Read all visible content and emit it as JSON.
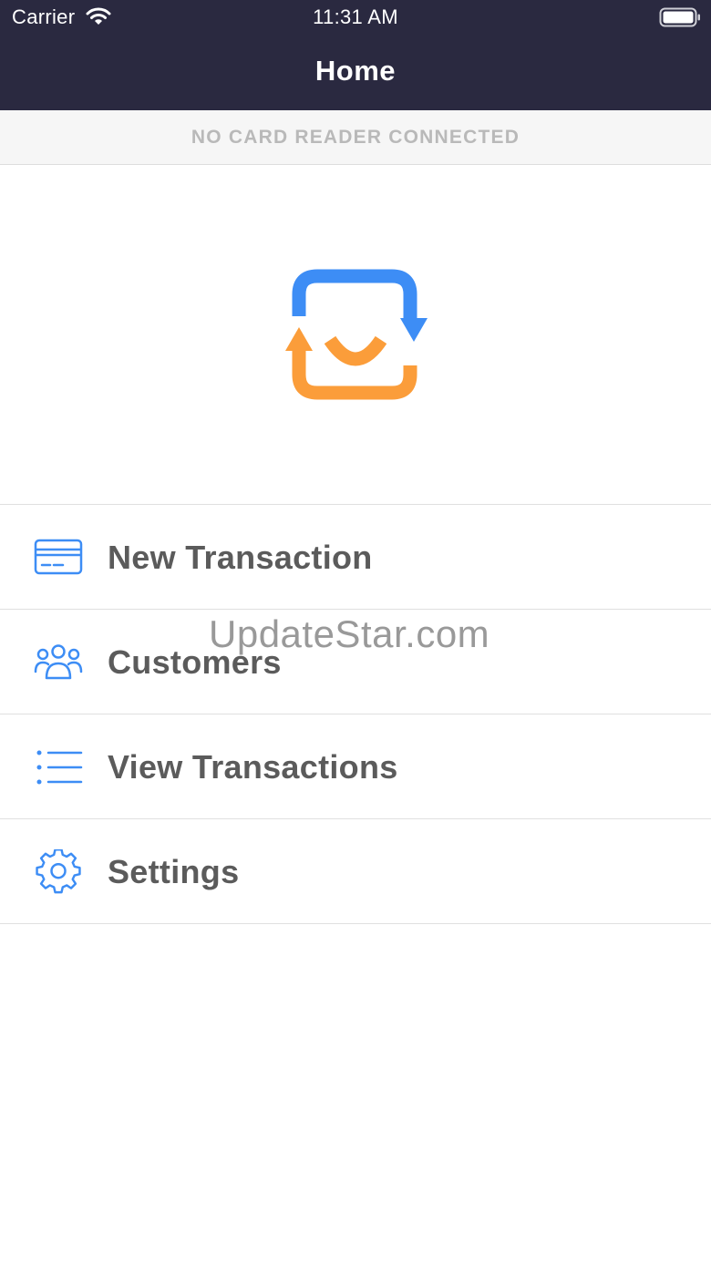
{
  "status_bar": {
    "carrier": "Carrier",
    "time": "11:31 AM"
  },
  "header": {
    "title": "Home"
  },
  "banner": {
    "text": "NO CARD READER CONNECTED"
  },
  "menu": {
    "items": [
      {
        "label": "New Transaction",
        "icon": "credit-card-icon"
      },
      {
        "label": "Customers",
        "icon": "users-icon"
      },
      {
        "label": "View Transactions",
        "icon": "list-icon"
      },
      {
        "label": "Settings",
        "icon": "gear-icon"
      }
    ]
  },
  "watermark": {
    "text": "UpdateStar.com"
  },
  "colors": {
    "navbar": "#2a2940",
    "accent_blue": "#3d8df5",
    "accent_orange": "#fb9d3a",
    "menu_text": "#5b5b5b",
    "banner_text": "#b9b9b9"
  }
}
